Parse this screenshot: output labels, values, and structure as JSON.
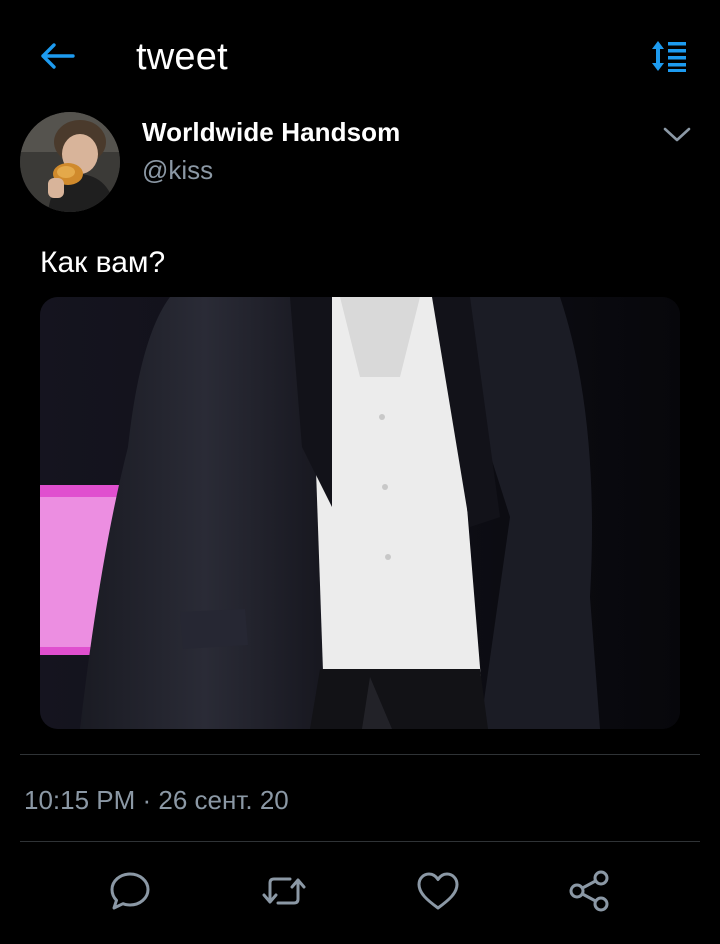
{
  "header": {
    "title": "tweet",
    "back_icon": "arrow-left-icon",
    "sort_icon": "sort-list-icon",
    "accent_color": "#1d9bf0"
  },
  "tweet": {
    "author": {
      "display_name": "Worldwide Handsom",
      "handle": "@kiss"
    },
    "text": "Как вам?",
    "timestamp": "10:15 PM · 26 сент. 20"
  },
  "actions": {
    "reply_icon": "comment-icon",
    "retweet_icon": "retweet-icon",
    "like_icon": "heart-icon",
    "share_icon": "share-icon"
  },
  "colors": {
    "background": "#000000",
    "primary_text": "#ffffff",
    "secondary_text": "#8b98a5",
    "divider": "#2f3336",
    "icon": "#8b98a5"
  }
}
